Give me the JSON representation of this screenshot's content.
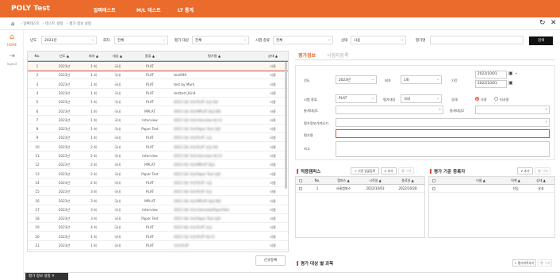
{
  "app": {
    "title": "POLY Test",
    "nav": [
      "알짜테스트",
      "M/L 테스트",
      "LT 통계"
    ],
    "breadcrumbs": [
      "알짜테스트",
      "테스트 설정",
      "평가 정보 설정"
    ],
    "refresh_icon": "↻",
    "close_icon": "✕"
  },
  "sidebar": {
    "items": [
      {
        "label": "HOME",
        "icon": "home-icon"
      },
      {
        "label": "logout",
        "icon": "logout-icon"
      }
    ]
  },
  "filter": {
    "year_label": "년도",
    "year_value": "2023년",
    "round_label": "회차",
    "round_value": "전체",
    "target_label": "평가 대상",
    "target_value": "전체",
    "type_label": "시험 종류",
    "type_value": "전체",
    "status_label": "상태",
    "status_value": "사용",
    "name_label": "평가명",
    "name_value": "",
    "search_button": "검색"
  },
  "grid": {
    "columns": [
      "No.",
      "년도 ▲",
      "회차 ▲",
      "대상 ▲",
      "종류 ▲",
      "평가명 ▲",
      "상태 ▲"
    ],
    "rows": [
      {
        "no": "1",
        "year": "2023년",
        "round": "1 회",
        "target": "국내",
        "type": "PLAT",
        "name": "",
        "status": "사용",
        "blur": false
      },
      {
        "no": "2",
        "year": "2023년",
        "round": "1 회",
        "target": "국내",
        "type": "PLAT",
        "name": "test999",
        "status": "사용",
        "blur": false
      },
      {
        "no": "3",
        "year": "2023년",
        "round": "1 회",
        "target": "국내",
        "type": "PLAT",
        "name": "test by Mark",
        "status": "사용",
        "blur": false
      },
      {
        "no": "4",
        "year": "2023년",
        "round": "1 회",
        "target": "국내",
        "type": "PLAT",
        "name": "testtest_Kind",
        "status": "사용",
        "blur": false
      },
      {
        "no": "5",
        "year": "2023년",
        "round": "1 회",
        "target": "국내",
        "type": "PLAT",
        "name": "2023 1회 국내 PLAT 초급 A반",
        "status": "사용",
        "blur": true
      },
      {
        "no": "6",
        "year": "2023년",
        "round": "1 회",
        "target": "국내",
        "type": "MPLAT",
        "name": "2023 1회 국내 MPLAT 중급 B반",
        "status": "사용",
        "blur": true
      },
      {
        "no": "7",
        "year": "2023년",
        "round": "1 회",
        "target": "국내",
        "type": "Interview",
        "name": "2023 1회 국내 Interview 테스트",
        "status": "사용",
        "blur": true
      },
      {
        "no": "8",
        "year": "2023년",
        "round": "1 회",
        "target": "국내",
        "type": "Paper Test",
        "name": "2023 1회 국내 Paper Test 일반",
        "status": "사용",
        "blur": true
      },
      {
        "no": "9",
        "year": "2023년",
        "round": "1 회",
        "target": "국내",
        "type": "PLAT",
        "name": "2023 1회 국내 PLAT 고급",
        "status": "사용",
        "blur": true
      },
      {
        "no": "10",
        "year": "2023년",
        "round": "2 회",
        "target": "국내",
        "type": "PLAT",
        "name": "2023 2회 국내 PLAT 초급 A반",
        "status": "사용",
        "blur": true
      },
      {
        "no": "11",
        "year": "2023년",
        "round": "2 회",
        "target": "국내",
        "type": "Interview",
        "name": "2023 2회 국내 Interview 테스트",
        "status": "사용",
        "blur": true
      },
      {
        "no": "12",
        "year": "2023년",
        "round": "2 회",
        "target": "국내",
        "type": "MPLAT",
        "name": "2023 2회 국내 MPLAT 중급",
        "status": "사용",
        "blur": true
      },
      {
        "no": "13",
        "year": "2023년",
        "round": "2 회",
        "target": "국내",
        "type": "Paper Test",
        "name": "2023 2회 국내 Paper Test 일반",
        "status": "사용",
        "blur": true
      },
      {
        "no": "14",
        "year": "2023년",
        "round": "2 회",
        "target": "국내",
        "type": "PLAT",
        "name": "2023 2회 국내 PLAT 고급",
        "status": "사용",
        "blur": true
      },
      {
        "no": "15",
        "year": "2023년",
        "round": "3 회",
        "target": "국내",
        "type": "PLAT",
        "name": "2023 3회 국내 PLAT 초급",
        "status": "사용",
        "blur": true
      },
      {
        "no": "16",
        "year": "2023년",
        "round": "3 회",
        "target": "국내",
        "type": "MPLAT",
        "name": "2023 3회 국내 MPLAT 중급 B반",
        "status": "사용",
        "blur": true
      },
      {
        "no": "17",
        "year": "2023년",
        "round": "3 회",
        "target": "국내",
        "type": "Interview",
        "name": "2023 3회 국내 Interview/PaperTest",
        "status": "사용",
        "blur": true
      },
      {
        "no": "18",
        "year": "2023년",
        "round": "3 회",
        "target": "국내",
        "type": "Paper Test",
        "name": "2023 3회 국내 Paper Test 일반",
        "status": "사용",
        "blur": true
      },
      {
        "no": "19",
        "year": "2023년",
        "round": "4 회",
        "target": "국내",
        "type": "PLAT",
        "name": "2023 4회 국내 PLAT 초급",
        "status": "사용",
        "blur": true
      },
      {
        "no": "20",
        "year": "2023년",
        "round": "1 회",
        "target": "국내",
        "type": "PLAT",
        "name": "2023 1회 국내 PLAT 테스트",
        "status": "사용",
        "blur": true
      },
      {
        "no": "21",
        "year": "2023년",
        "round": "1 회",
        "target": "국내",
        "type": "PLAT",
        "name": "국내 PLAT",
        "status": "사용",
        "blur": true
      }
    ]
  },
  "new_button": "신규등록",
  "detail": {
    "tab_active": "평가정보",
    "tab_inactive": "시험지등록",
    "year_label": "년도",
    "year_value": "2023년",
    "round_label": "회차",
    "round_value": "1회",
    "period_label": "기간",
    "period_start": "2022/10/01",
    "period_end": "2022/10/01",
    "type_label": "시험 종류",
    "type_value": "PLAT",
    "target_label": "평가대상",
    "target_value": "국내",
    "status_label": "상태",
    "status_on": "사용",
    "status_off": "미사용",
    "test1_label": "통계대상1",
    "test2_label": "통계대상2",
    "info_label": "평가정보가져오기",
    "name_label": "평가명",
    "memo_label": "비고"
  },
  "campus": {
    "title": "적용캠퍼스",
    "add_btn": "+ 기관 일괄등록",
    "up_btn": "✔ 추가",
    "del_btn": "🗑 삭제",
    "columns": [
      "No.",
      "캠퍼스 ▲",
      "시작일 ▲",
      "종료일 ▲"
    ],
    "rows": [
      {
        "no": "1",
        "campus": "서울캠퍼스",
        "start": "2022/10/03",
        "end": "2022/10/28"
      }
    ]
  },
  "criteria": {
    "title": "평가 기준 등록자",
    "up_btn": "✔ 추가",
    "del_btn": "🗑 삭제",
    "columns": [
      "이름 ▲",
      "직책 ▲",
      "상태 ▲"
    ],
    "rows": [
      {
        "name": "",
        "role": "선임",
        "status": "유효"
      }
    ]
  },
  "bottom_section": {
    "title": "평가 대상 별 과목",
    "add_btn": "+ 평가과목추가",
    "del_btn": "🗑 삭제"
  },
  "bottom_tab": "평가 정보 설정 ✕"
}
